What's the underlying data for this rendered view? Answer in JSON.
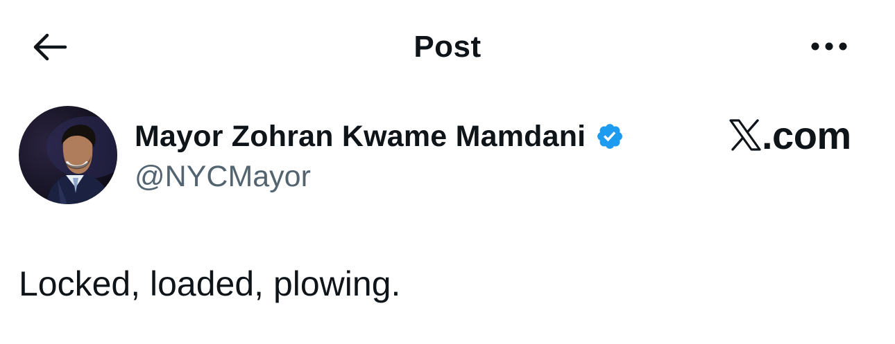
{
  "header": {
    "title": "Post",
    "back_icon": "arrow-left-icon",
    "more_icon": "more-horizontal-icon"
  },
  "author": {
    "display_name": "Mayor Zohran Kwame Mamdani",
    "handle": "@NYCMayor",
    "verified": true,
    "verified_color": "#1d9bf0"
  },
  "brand": {
    "text": ".com"
  },
  "post": {
    "text": "Locked, loaded, plowing."
  },
  "colors": {
    "text_primary": "#0f1419",
    "text_secondary": "#536471",
    "background": "#ffffff"
  }
}
